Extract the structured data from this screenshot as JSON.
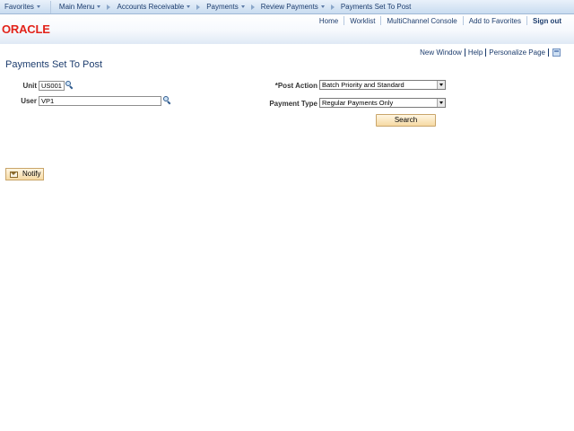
{
  "topnav": {
    "favorites": "Favorites",
    "main_menu": "Main Menu",
    "breadcrumbs": [
      "Accounts Receivable",
      "Payments",
      "Review Payments",
      "Payments Set To Post"
    ]
  },
  "header": {
    "logo": "ORACLE",
    "links": [
      "Home",
      "Worklist",
      "MultiChannel Console",
      "Add to Favorites",
      "Sign out"
    ]
  },
  "page_links": [
    "New Window",
    "Help",
    "Personalize Page"
  ],
  "page_title": "Payments Set To Post",
  "form": {
    "unit_label": "Unit",
    "unit_value": "US001",
    "user_label": "User",
    "user_value": "VP1",
    "post_action_label": "*Post Action",
    "post_action_value": "Batch Priority and Standard",
    "payment_type_label": "Payment Type",
    "payment_type_value": "Regular Payments Only",
    "search_label": "Search"
  },
  "notify_label": "Notify",
  "colors": {
    "nav_text": "#1d3d6e",
    "logo_red": "#e2231a",
    "button_fill": "#f6d9a3",
    "button_border": "#c9a56a"
  }
}
